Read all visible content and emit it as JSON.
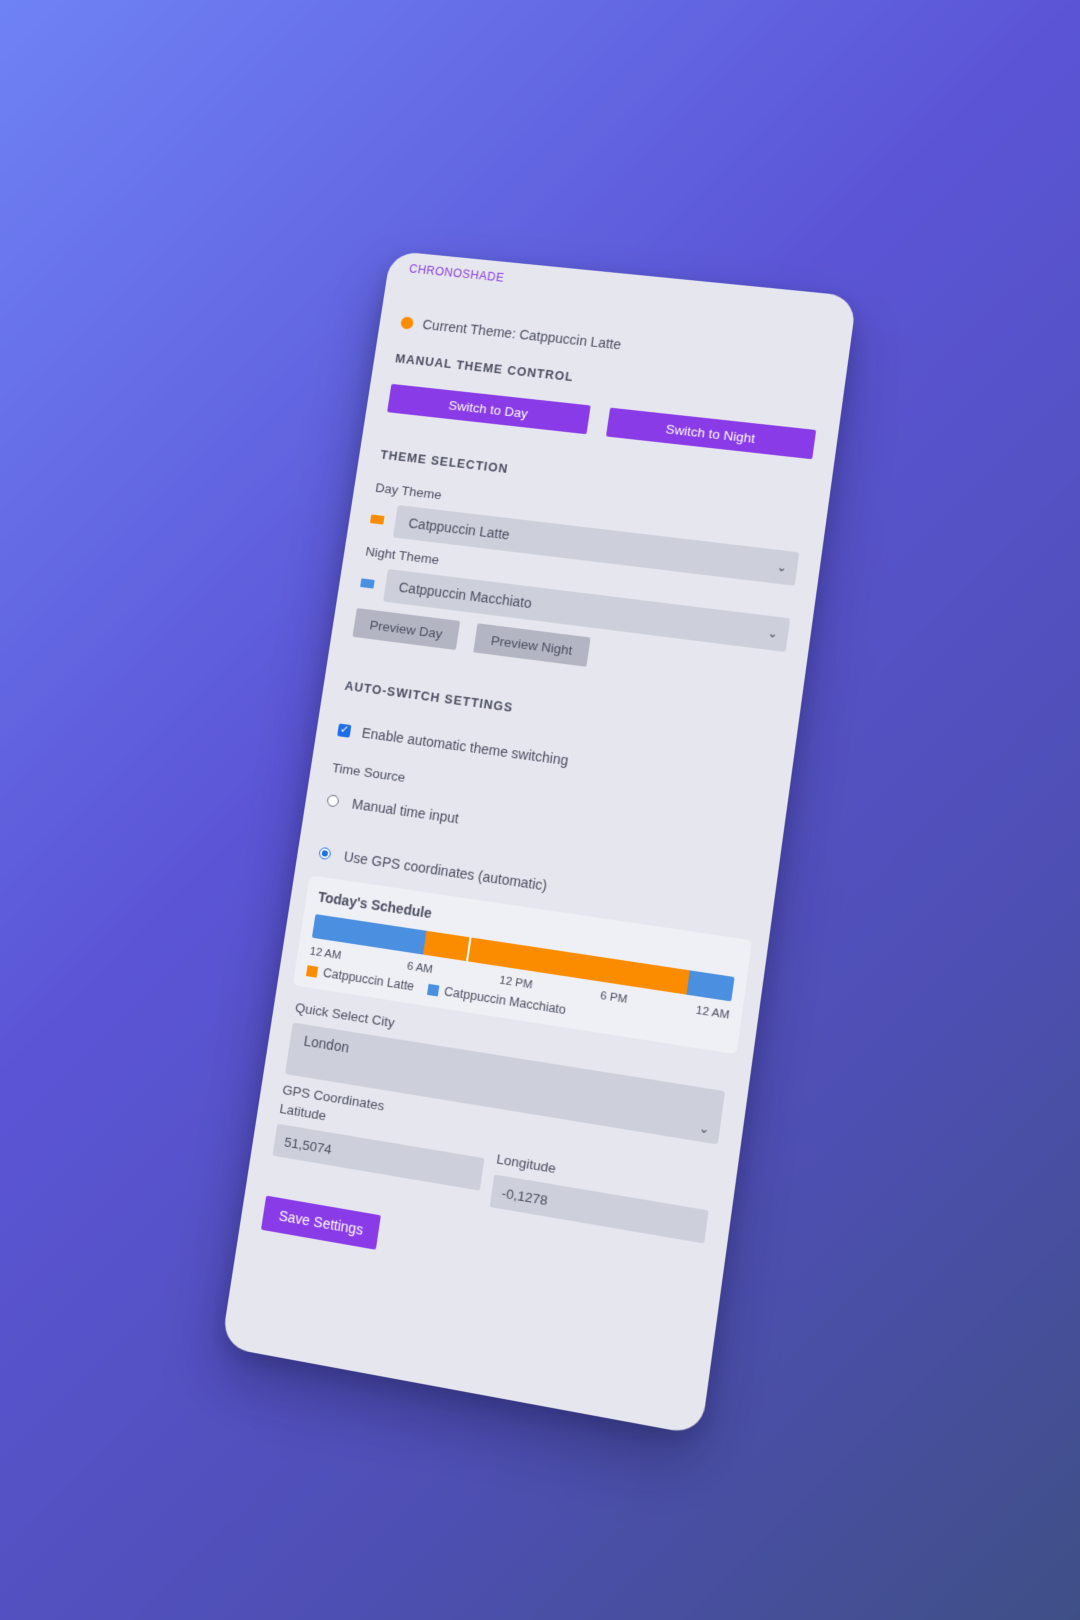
{
  "app": {
    "brand": "CHRONOSHADE",
    "current_theme_text": "Current Theme: Catppuccin Latte",
    "current_theme_color": "#fb8c00"
  },
  "manual": {
    "title": "MANUAL THEME CONTROL",
    "switch_day": "Switch to Day",
    "switch_night": "Switch to Night"
  },
  "theme_selection": {
    "title": "THEME SELECTION",
    "day_label": "Day Theme",
    "day_value": "Catppuccin Latte",
    "day_color": "#fb8c00",
    "night_label": "Night Theme",
    "night_value": "Catppuccin Macchiato",
    "night_color": "#4a8fe0",
    "preview_day": "Preview Day",
    "preview_night": "Preview Night"
  },
  "auto": {
    "title": "AUTO-SWITCH SETTINGS",
    "enable_label": "Enable automatic theme switching",
    "enabled": true,
    "time_source_label": "Time Source",
    "option_manual": "Manual time input",
    "option_gps": "Use GPS coordinates (automatic)",
    "selected": "gps"
  },
  "schedule": {
    "title": "Today's Schedule",
    "ticks": [
      "12 AM",
      "6 AM",
      "12 PM",
      "6 PM",
      "12 AM"
    ],
    "segments": [
      {
        "theme": "Catppuccin Macchiato",
        "from_hour": 0,
        "to_hour": 6.5,
        "color": "#4a8fe0"
      },
      {
        "theme": "Catppuccin Latte",
        "from_hour": 6.5,
        "to_hour": 21.5,
        "color": "#fb8c00"
      },
      {
        "theme": "Catppuccin Macchiato",
        "from_hour": 21.5,
        "to_hour": 24,
        "color": "#4a8fe0"
      }
    ],
    "now_hour": 9,
    "legend": [
      {
        "label": "Catppuccin Latte",
        "color": "#fb8c00"
      },
      {
        "label": "Catppuccin Macchiato",
        "color": "#4a8fe0"
      }
    ]
  },
  "city": {
    "label": "Quick Select City",
    "value": "London"
  },
  "gps": {
    "title": "GPS Coordinates",
    "lat_label": "Latitude",
    "lat_value": "51,5074",
    "lon_label": "Longitude",
    "lon_value": "-0,1278"
  },
  "save_label": "Save Settings"
}
